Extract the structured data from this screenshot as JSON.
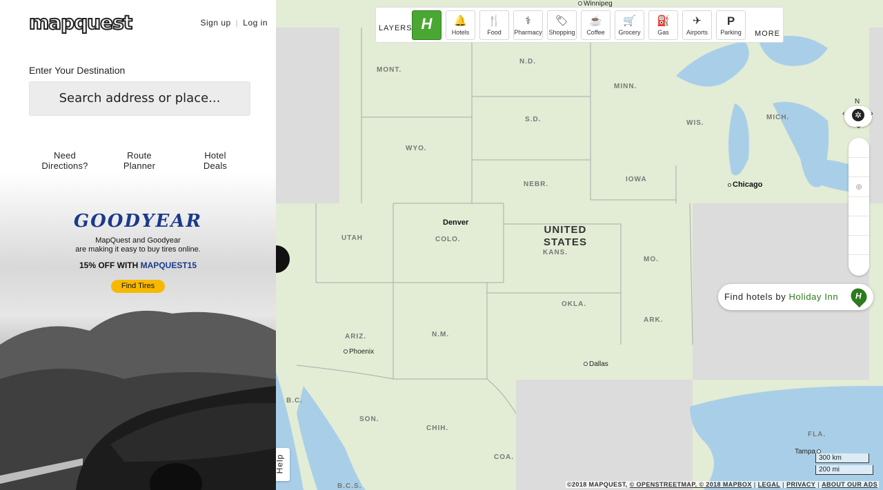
{
  "sidebar": {
    "logo_text": "mapquest",
    "auth": {
      "signup": "Sign up",
      "login": "Log in"
    },
    "destination_label": "Enter Your Destination",
    "search_placeholder": "Search address or place...",
    "quick_links": [
      {
        "line1": "Need",
        "line2": "Directions?"
      },
      {
        "line1": "Route",
        "line2": "Planner"
      },
      {
        "line1": "Hotel",
        "line2": "Deals"
      }
    ],
    "ad": {
      "brand": "GOODYEAR",
      "line1": "MapQuest and Goodyear",
      "line2": "are making it easy to buy tires online.",
      "promo_prefix": "15% OFF WITH ",
      "promo_code": "MAPQUEST15",
      "cta": "Find Tires"
    }
  },
  "toolbar": {
    "layers_label": "LAYERS",
    "buttons": [
      {
        "label": "Hotels",
        "icon": "bell-icon"
      },
      {
        "label": "Food",
        "icon": "fork-knife-icon"
      },
      {
        "label": "Pharmacy",
        "icon": "pill-bottle-icon"
      },
      {
        "label": "Shopping",
        "icon": "tag-icon"
      },
      {
        "label": "Coffee",
        "icon": "coffee-icon"
      },
      {
        "label": "Grocery",
        "icon": "cart-icon"
      },
      {
        "label": "Gas",
        "icon": "gas-pump-icon"
      },
      {
        "label": "Airports",
        "icon": "plane-icon"
      },
      {
        "label": "Parking",
        "icon": "parking-icon"
      }
    ],
    "more_label": "MORE"
  },
  "map": {
    "country_label_line1": "UNITED",
    "country_label_line2": "STATES",
    "states": {
      "mont": "MONT.",
      "nd": "N.D.",
      "minn": "MINN.",
      "sd": "S.D.",
      "wis": "WIS.",
      "mich": "MICH.",
      "wyo": "WYO.",
      "nebr": "NEBR.",
      "iowa": "IOWA",
      "utah": "UTAH",
      "colo": "COLO.",
      "kans": "KANS.",
      "mo": "MO.",
      "okla": "OKLA.",
      "ark": "ARK.",
      "ariz": "ARIZ.",
      "nm": "N.M.",
      "bc": "B.C.",
      "son": "SON.",
      "chih": "CHIH.",
      "coa": "COA.",
      "fla": "FLA.",
      "bcs": "B.C.S."
    },
    "cities": {
      "winnipeg": "Winnipeg",
      "chicago": "Chicago",
      "denver": "Denver",
      "phoenix": "Phoenix",
      "dallas": "Dallas",
      "tampa": "Tampa"
    },
    "compass_north": "N",
    "hotel_promo_prefix": "Find hotels by ",
    "hotel_promo_brand": "Holiday Inn",
    "help_label": "Help",
    "scale_km": "300 km",
    "scale_mi": "200 mi",
    "footer": {
      "copyright": "©2018 MAPQUEST,",
      "osm": "© OPENSTREETMAP, © 2018 MAPBOX",
      "legal": "LEGAL",
      "privacy": "PRIVACY",
      "ads": "ABOUT OUR ADS"
    }
  },
  "colors": {
    "map_land": "#e3ecd5",
    "water": "#a9cfe8",
    "unloaded_tile": "#dcdcdc",
    "holiday_inn_green": "#4aa832",
    "goodyear_blue": "#1a3a8a",
    "cta_yellow": "#f7b900"
  }
}
